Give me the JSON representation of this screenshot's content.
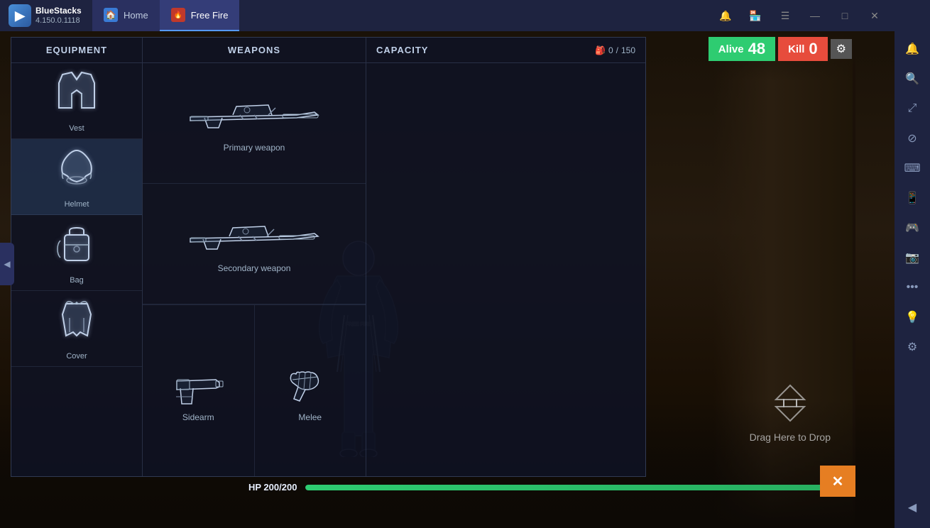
{
  "app": {
    "name": "BlueStacks",
    "version": "4.150.0.1118"
  },
  "tabs": [
    {
      "id": "home",
      "label": "Home",
      "active": false
    },
    {
      "id": "freefire",
      "label": "Free Fire",
      "active": true
    }
  ],
  "window_controls": {
    "notification": "🔔",
    "search": "🔍",
    "menu": "☰",
    "minimize": "—",
    "maximize": "□",
    "close": "✕"
  },
  "hud": {
    "alive_label": "Alive",
    "alive_count": "48",
    "kill_label": "Kill",
    "kill_count": "0"
  },
  "inventory": {
    "equipment_header": "EQUIPMENT",
    "weapons_header": "WEAPONS",
    "capacity_header": "CAPACITY",
    "capacity_current": "0",
    "capacity_max": "150",
    "equipment_items": [
      {
        "id": "vest",
        "label": "Vest",
        "icon": "🦺"
      },
      {
        "id": "helmet",
        "label": "Helmet",
        "icon": "⛑️"
      },
      {
        "id": "bag",
        "label": "Bag",
        "icon": "🎒"
      },
      {
        "id": "cover",
        "label": "Cover",
        "icon": "🧥"
      }
    ],
    "weapon_slots": [
      {
        "id": "primary",
        "label": "Primary weapon"
      },
      {
        "id": "secondary",
        "label": "Secondary weapon"
      },
      {
        "id": "sidearm",
        "label": "Sidearm"
      },
      {
        "id": "melee",
        "label": "Melee"
      }
    ]
  },
  "hp": {
    "label": "HP",
    "current": "200",
    "max": "200",
    "display": "HP  200/200",
    "percent": 100
  },
  "drag_drop": {
    "text": "Drag Here to Drop"
  },
  "close_btn": "✕",
  "sidebar_icons": [
    "🔔",
    "🔍",
    "⤢",
    "⊘",
    "⌨",
    "📱",
    "🎮",
    "📷",
    "…",
    "💡",
    "⚙"
  ]
}
